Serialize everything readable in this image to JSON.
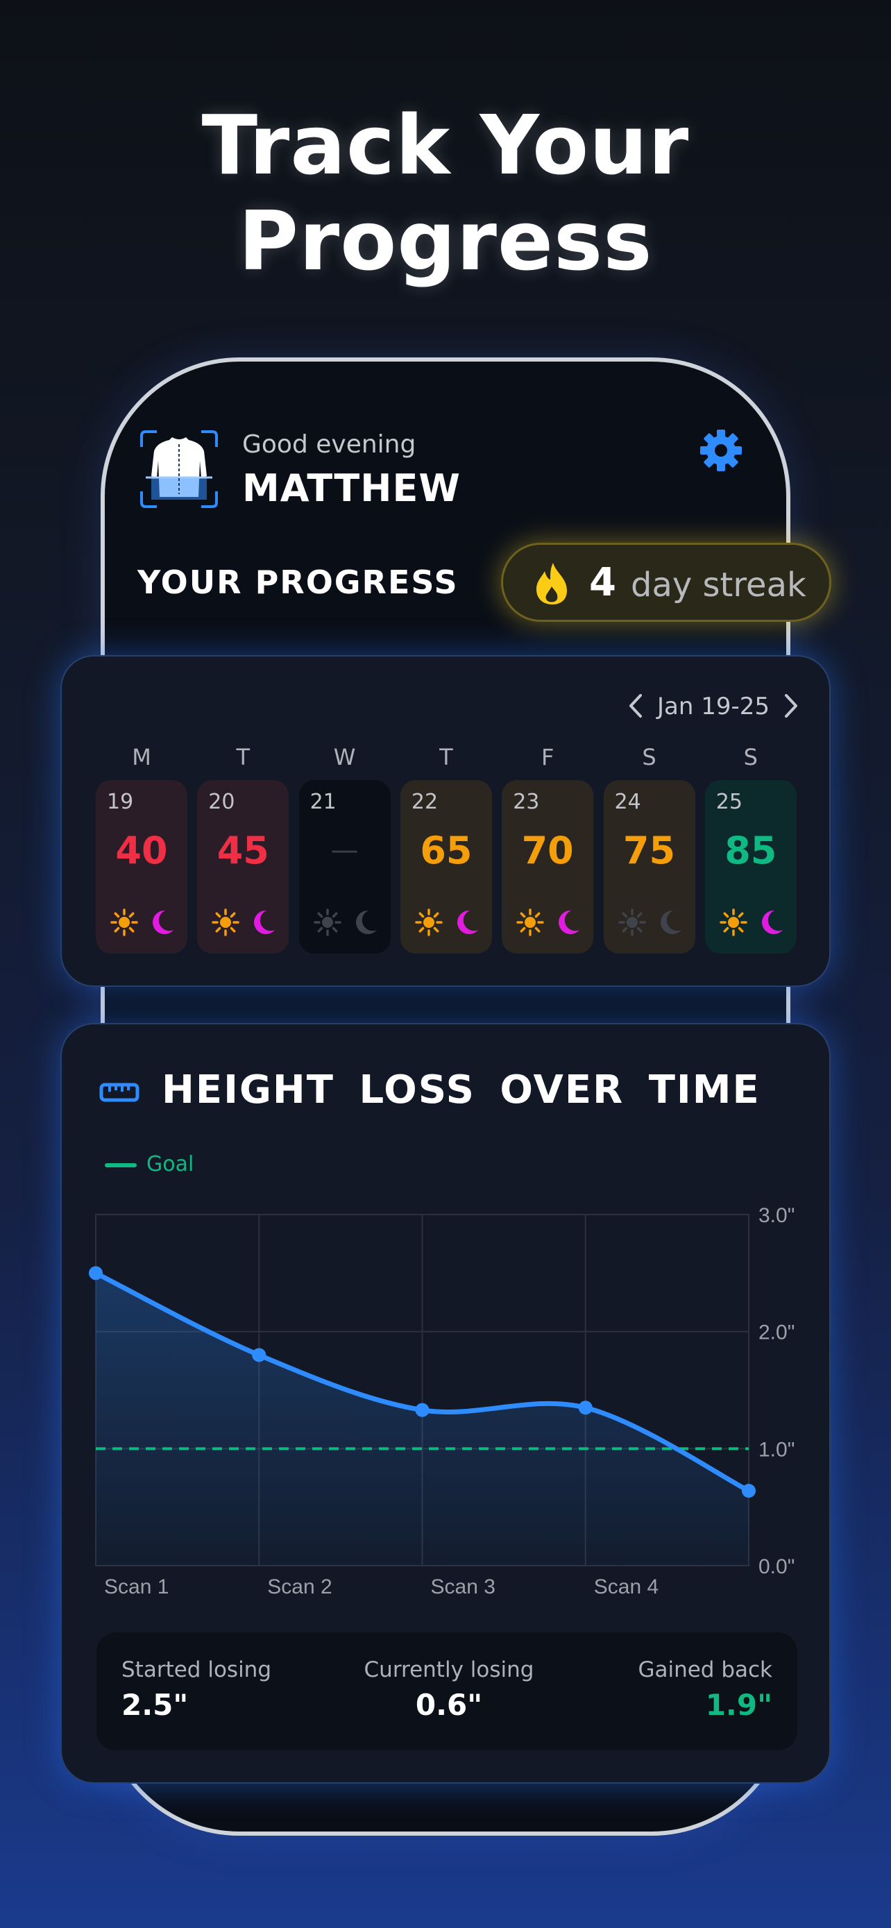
{
  "headline": {
    "line1": "Track Your",
    "line2": "Progress"
  },
  "header": {
    "greeting": "Good evening",
    "name": "MATTHEW",
    "settings_icon": "gear-icon",
    "logo_icon": "back-scan-logo"
  },
  "progress": {
    "title": "YOUR PROGRESS",
    "streak_count": "4",
    "streak_label": "day streak",
    "streak_icon": "flame-icon"
  },
  "week": {
    "range": "Jan 19-25",
    "days": [
      {
        "letter": "M",
        "date": "19",
        "score": "40",
        "status": "low",
        "sun": true,
        "moon": true
      },
      {
        "letter": "T",
        "date": "20",
        "score": "45",
        "status": "low",
        "sun": true,
        "moon": true
      },
      {
        "letter": "W",
        "date": "21",
        "score": "—",
        "status": "none",
        "sun": false,
        "moon": false
      },
      {
        "letter": "T",
        "date": "22",
        "score": "65",
        "status": "mid",
        "sun": true,
        "moon": true
      },
      {
        "letter": "F",
        "date": "23",
        "score": "70",
        "status": "mid",
        "sun": true,
        "moon": true
      },
      {
        "letter": "S",
        "date": "24",
        "score": "75",
        "status": "mid",
        "sun": false,
        "moon": false
      },
      {
        "letter": "S",
        "date": "25",
        "score": "85",
        "status": "high",
        "sun": true,
        "moon": true
      }
    ]
  },
  "colors": {
    "low": "#ef2f45",
    "mid": "#f59e0b",
    "high": "#10b981",
    "accent": "#2f8cff",
    "moon": "#e11ce0",
    "sun": "#f59e0b"
  },
  "chart": {
    "title": "HEIGHT LOSS OVER TIME",
    "title_icon": "ruler-icon",
    "legend_goal": "Goal"
  },
  "chart_data": {
    "type": "area",
    "categories": [
      "Scan 1",
      "Scan 2",
      "Scan 3",
      "Scan 4",
      ""
    ],
    "values": [
      2.5,
      1.8,
      1.33,
      1.35,
      0.64
    ],
    "goal": 1.0,
    "y_ticks": [
      "0.0\"",
      "1.0\"",
      "2.0\"",
      "3.0\""
    ],
    "ylim": [
      0,
      3
    ],
    "grid": true,
    "legend": "top-left"
  },
  "stats": {
    "started_label": "Started losing",
    "started_value": "2.5\"",
    "current_label": "Currently losing",
    "current_value": "0.6\"",
    "gained_label": "Gained back",
    "gained_value": "1.9\""
  }
}
